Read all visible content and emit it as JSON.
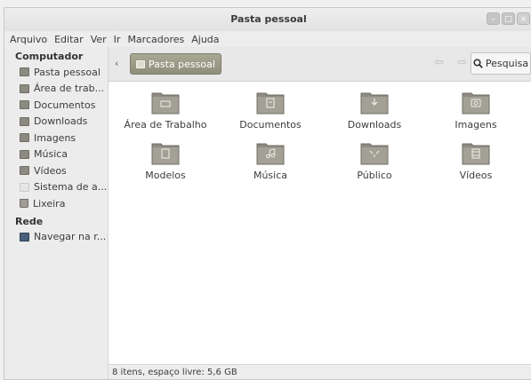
{
  "window": {
    "title": "Pasta pessoal"
  },
  "menubar": [
    "Arquivo",
    "Editar",
    "Ver",
    "Ir",
    "Marcadores",
    "Ajuda"
  ],
  "sidebar": {
    "sections": [
      {
        "heading": "Computador",
        "items": [
          {
            "label": "Pasta pessoal",
            "icon": "home-folder-icon"
          },
          {
            "label": "Área de trab...",
            "icon": "desktop-folder-icon"
          },
          {
            "label": "Documentos",
            "icon": "documents-folder-icon"
          },
          {
            "label": "Downloads",
            "icon": "downloads-folder-icon"
          },
          {
            "label": "Imagens",
            "icon": "pictures-folder-icon"
          },
          {
            "label": "Música",
            "icon": "music-folder-icon"
          },
          {
            "label": "Vídeos",
            "icon": "videos-folder-icon"
          },
          {
            "label": "Sistema de a...",
            "icon": "filesystem-icon"
          },
          {
            "label": "Lixeira",
            "icon": "trash-icon"
          }
        ]
      },
      {
        "heading": "Rede",
        "items": [
          {
            "label": "Navegar na r...",
            "icon": "network-icon"
          }
        ]
      }
    ]
  },
  "toolbar": {
    "path": "Pasta pessoal",
    "search": "Pesquisa"
  },
  "folders": [
    {
      "label": "Área de Trabalho",
      "icon": "desktop"
    },
    {
      "label": "Documentos",
      "icon": "documents"
    },
    {
      "label": "Downloads",
      "icon": "downloads"
    },
    {
      "label": "Imagens",
      "icon": "pictures"
    },
    {
      "label": "Modelos",
      "icon": "templates"
    },
    {
      "label": "Música",
      "icon": "music"
    },
    {
      "label": "Público",
      "icon": "public"
    },
    {
      "label": "Vídeos",
      "icon": "videos"
    }
  ],
  "status": "8 itens, espaço livre: 5,6 GB",
  "colors": {
    "folder": "#8d8b81",
    "path_button": "#9a9986"
  }
}
